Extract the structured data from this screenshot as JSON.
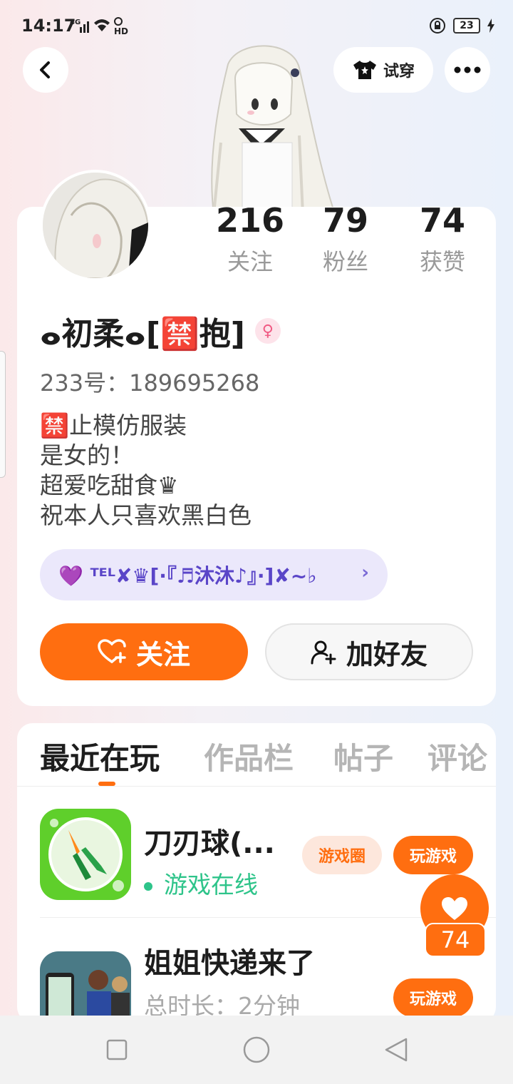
{
  "status_bar": {
    "time": "14:17",
    "network": "4G",
    "hd": "HD",
    "battery": "23"
  },
  "header": {
    "tryon_label": "试穿"
  },
  "profile": {
    "stats": [
      {
        "value": "216",
        "label": "关注"
      },
      {
        "value": "79",
        "label": "粉丝"
      },
      {
        "value": "74",
        "label": "获赞"
      }
    ],
    "nickname": "ⴰ初柔ⴰ[🈲抱]",
    "gender": "♀",
    "uid": "233号：189695268",
    "bio": [
      "🈲止模仿服装",
      "是女的！",
      "超爱吃甜食♛",
      "祝本人只喜欢黑白色"
    ],
    "club_label": "💜 ᵀᴱᴸ✘♛[·『♬沐沐♪』·]✘~♭",
    "follow_label": "关注",
    "add_friend_label": "加好友"
  },
  "tabs": [
    "最近在玩",
    "作品栏",
    "帖子",
    "评论"
  ],
  "games": [
    {
      "title": "刀刃球(...",
      "status": "游戏在线",
      "circle_label": "游戏圈",
      "play_label": "玩游戏"
    },
    {
      "title": "姐姐快递来了",
      "status": "总时长：2分钟",
      "play_label": "玩游戏"
    }
  ],
  "like": {
    "count": "74"
  },
  "colors": {
    "accent": "#ff6e10",
    "online": "#2ec48a",
    "club_bg": "#ebe8fb"
  }
}
